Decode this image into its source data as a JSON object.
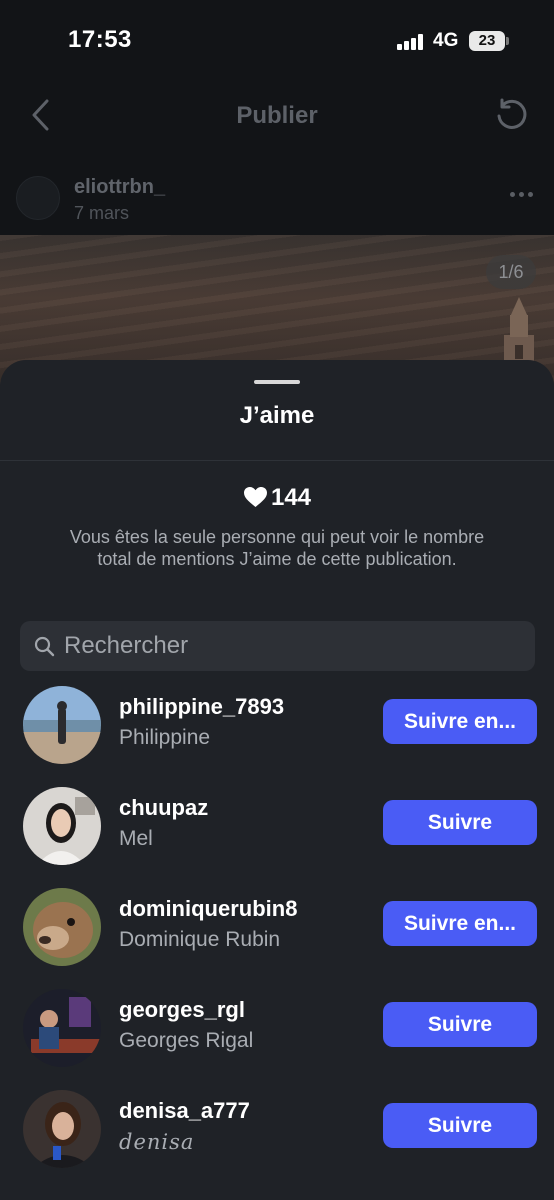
{
  "status_bar": {
    "time": "17:53",
    "network": "4G",
    "battery": "23"
  },
  "post": {
    "header_title": "Publier",
    "author": "eliottrbn_",
    "date": "7 mars",
    "image_counter": "1/6"
  },
  "sheet": {
    "title": "J’aime",
    "likes_count": "144",
    "likes_note": "Vous êtes la seule personne qui peut voir le nombre total de mentions J’aime de cette publication.",
    "search_placeholder": "Rechercher",
    "users": [
      {
        "username": "philippine_7893",
        "fullname": "Philippine",
        "button": "Suivre en..."
      },
      {
        "username": "chuupaz",
        "fullname": "Mel",
        "button": "Suivre"
      },
      {
        "username": "dominiquerubin8",
        "fullname": "Dominique Rubin",
        "button": "Suivre en..."
      },
      {
        "username": "georges_rgl",
        "fullname": "Georges Rigal",
        "button": "Suivre"
      },
      {
        "username": "denisa_a777",
        "fullname": "denisa",
        "button": "Suivre"
      }
    ]
  },
  "colors": {
    "accent": "#4a5cf5",
    "sheet_bg": "#1f2227",
    "secondary_text": "#a9adb3"
  }
}
